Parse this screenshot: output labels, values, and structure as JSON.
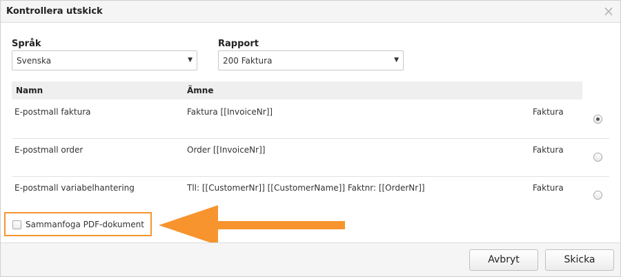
{
  "dialog": {
    "title": "Kontrollera utskick",
    "close_symbol": "×"
  },
  "language": {
    "label": "Språk",
    "selected": "Svenska"
  },
  "report": {
    "label": "Rapport",
    "selected": "200 Faktura"
  },
  "table": {
    "headers": [
      "Namn",
      "Ämne"
    ],
    "rows": [
      {
        "name": "E-postmall faktura",
        "subject": "Faktura [[InvoiceNr]]",
        "type": "Faktura",
        "selected": true
      },
      {
        "name": "E-postmall order",
        "subject": "Order [[InvoiceNr]]",
        "type": "Faktura",
        "selected": false
      },
      {
        "name": "E-postmall variabelhantering",
        "subject": "Tll: [[CustomerNr]] [[CustomerName]] Faktnr: [[OrderNr]]",
        "type": "Faktura",
        "selected": false
      }
    ]
  },
  "merge_pdf": {
    "label": "Sammanfoga PDF-dokument",
    "checked": false
  },
  "annotation": {
    "highlight_color": "#f7942e"
  },
  "buttons": {
    "cancel": "Avbryt",
    "send": "Skicka"
  },
  "icons": {
    "close": "close-icon",
    "caret": "chevron-down-icon",
    "arrow": "arrow-left-icon"
  }
}
